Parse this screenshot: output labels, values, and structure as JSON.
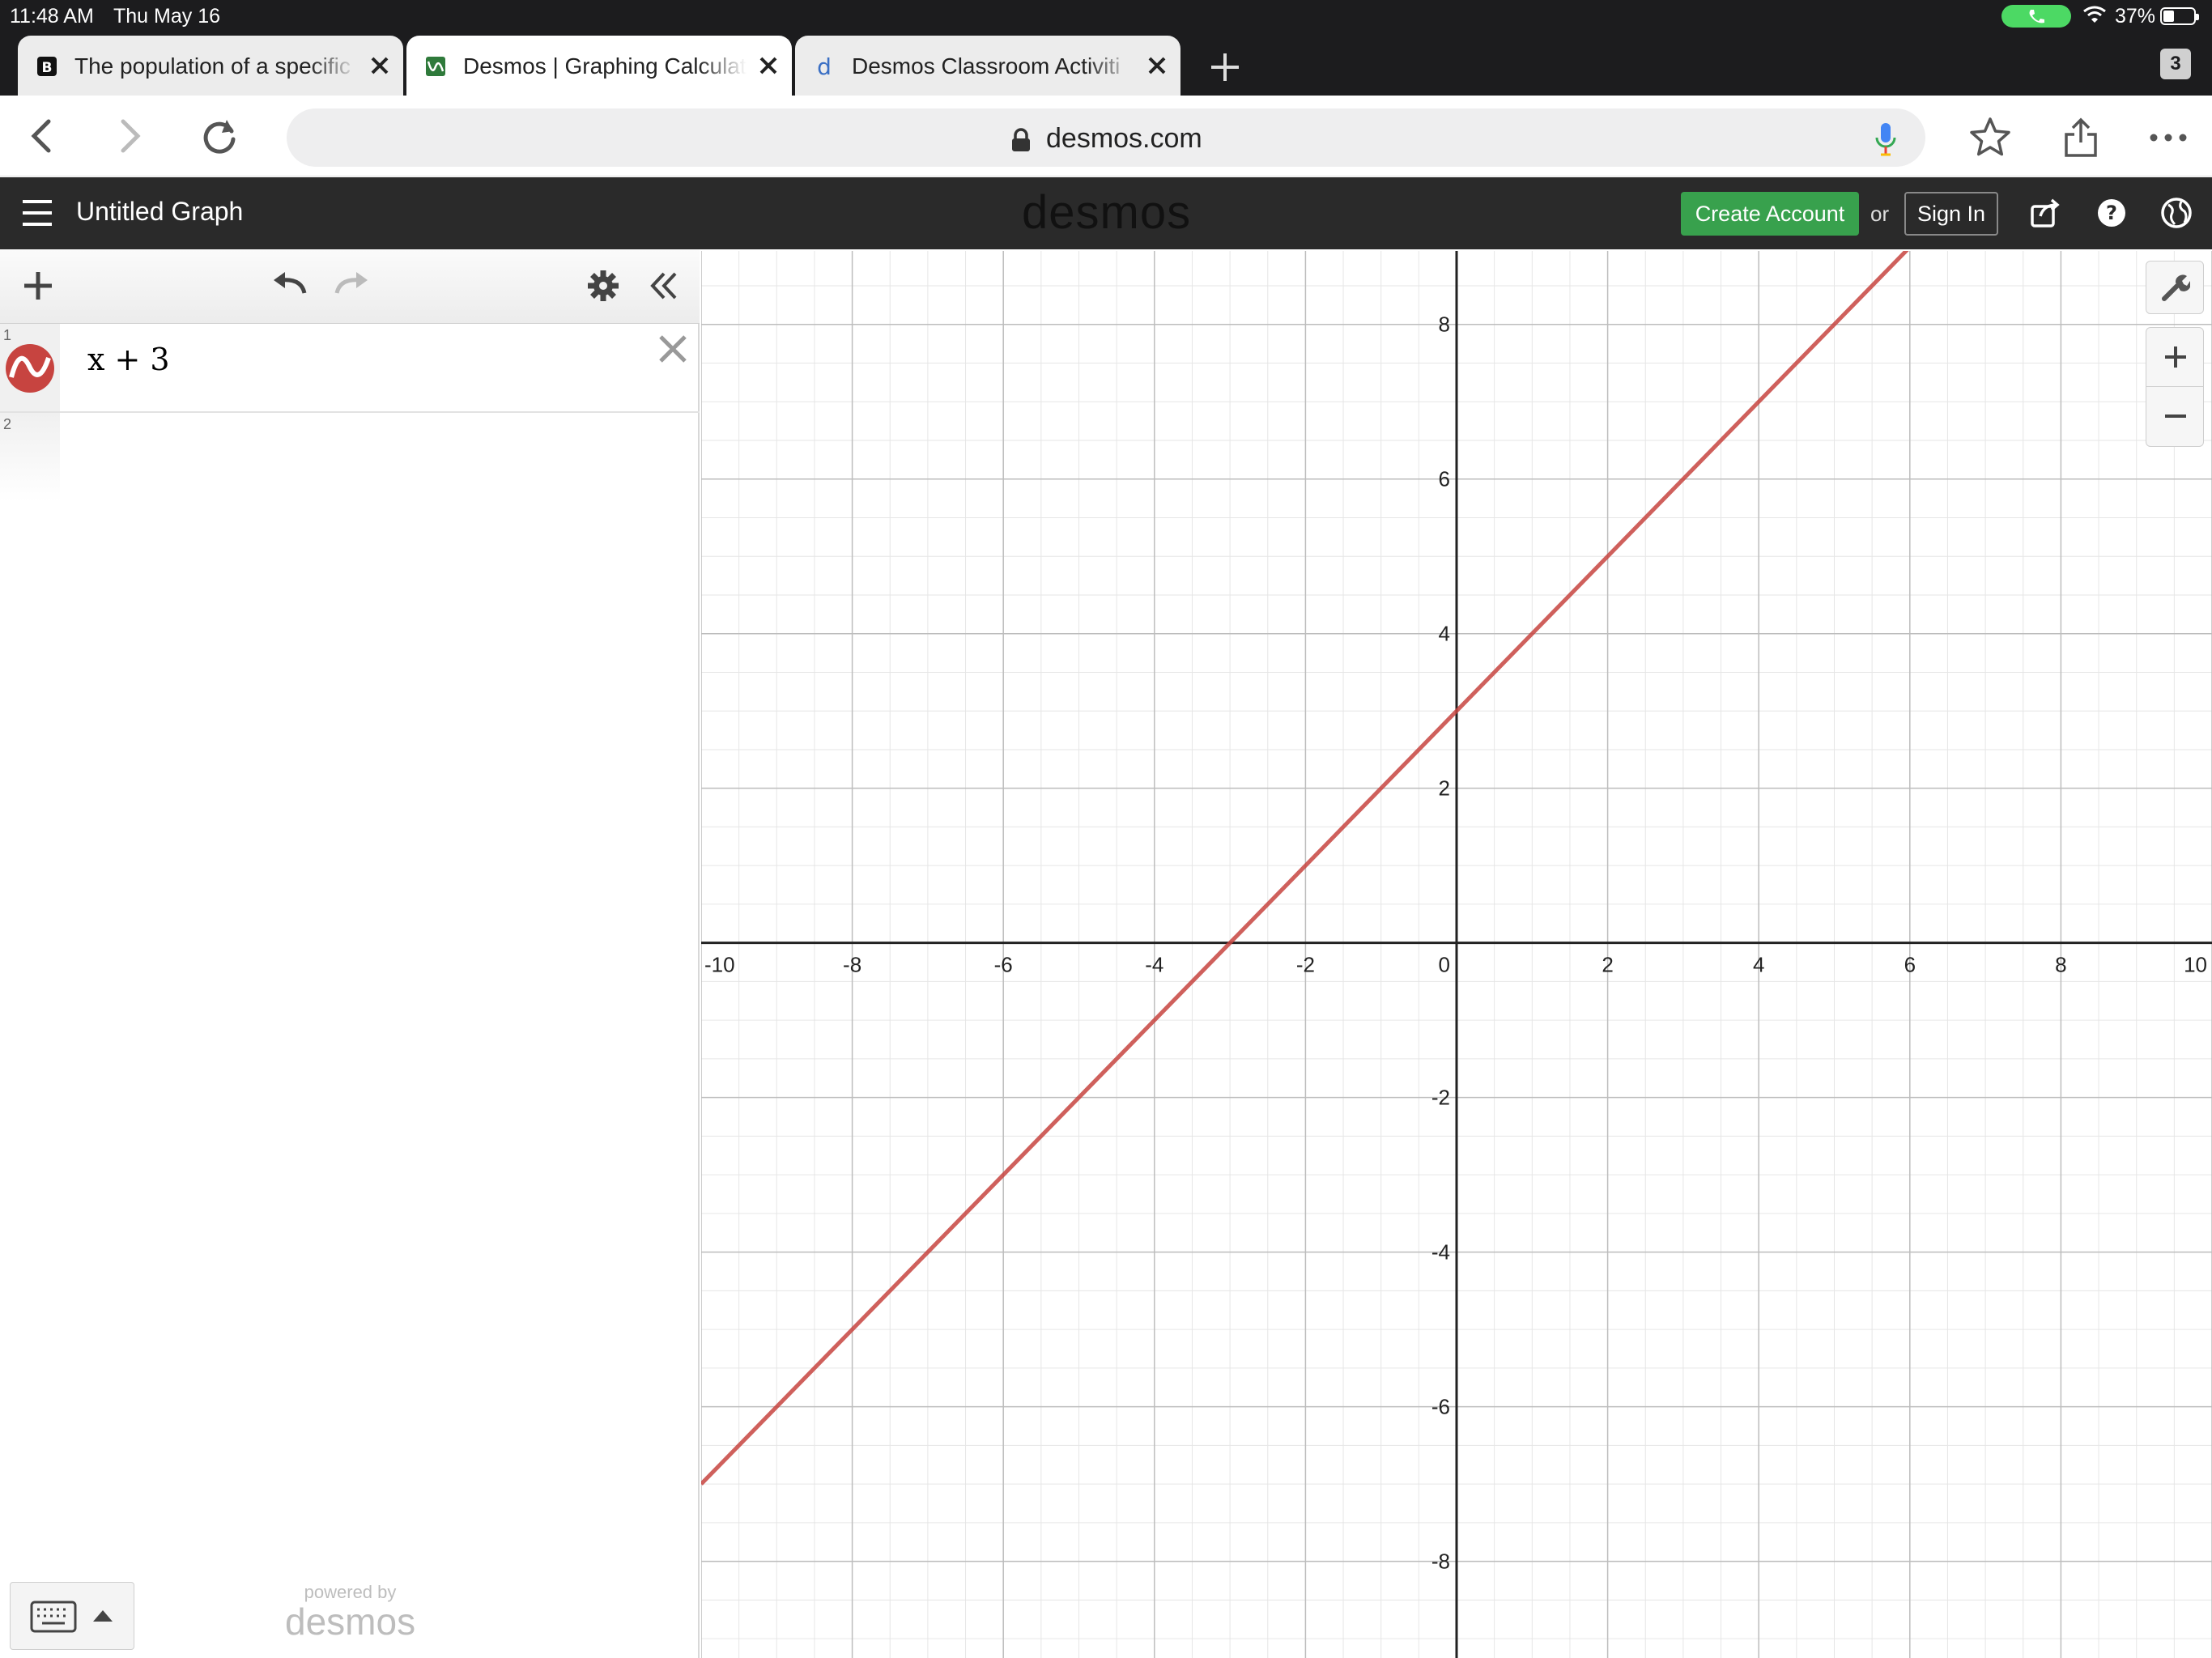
{
  "status_bar": {
    "time": "11:48 AM",
    "date": "Thu May 16",
    "battery_pct": "37%",
    "battery_level": 0.37
  },
  "tabs": [
    {
      "title": "The population of a specific",
      "active": false,
      "favicon": "brainly-icon"
    },
    {
      "title": "Desmos | Graphing Calculat",
      "active": true,
      "favicon": "desmos-graph-icon"
    },
    {
      "title": "Desmos Classroom Activiti",
      "active": false,
      "favicon": "desmos-d-icon"
    }
  ],
  "tab_count": "3",
  "address": {
    "url": "desmos.com"
  },
  "header": {
    "graph_title": "Untitled Graph",
    "logo": "desmos",
    "create_account": "Create Account",
    "or": "or",
    "sign_in": "Sign In"
  },
  "expressions": [
    {
      "index": "1",
      "latex": "x + 3",
      "color": "#c74440"
    },
    {
      "index": "2",
      "latex": ""
    }
  ],
  "footer": {
    "powered_by": "powered by",
    "brand": "desmos"
  },
  "colors": {
    "header_bg": "#2a2a2a",
    "create_account_bg": "#38a14d",
    "line": "#c74440"
  },
  "chart_data": {
    "type": "line",
    "xlim": [
      -10,
      10
    ],
    "ylim": [
      -9.25,
      8.95
    ],
    "x_ticks": [
      -10,
      -8,
      -6,
      -4,
      -2,
      0,
      2,
      4,
      6,
      8,
      10
    ],
    "y_ticks": [
      -8,
      -6,
      -4,
      -2,
      2,
      4,
      6,
      8
    ],
    "grid": true,
    "series": [
      {
        "name": "x + 3",
        "slope": 1,
        "intercept": 3,
        "color": "#c74440"
      }
    ]
  }
}
